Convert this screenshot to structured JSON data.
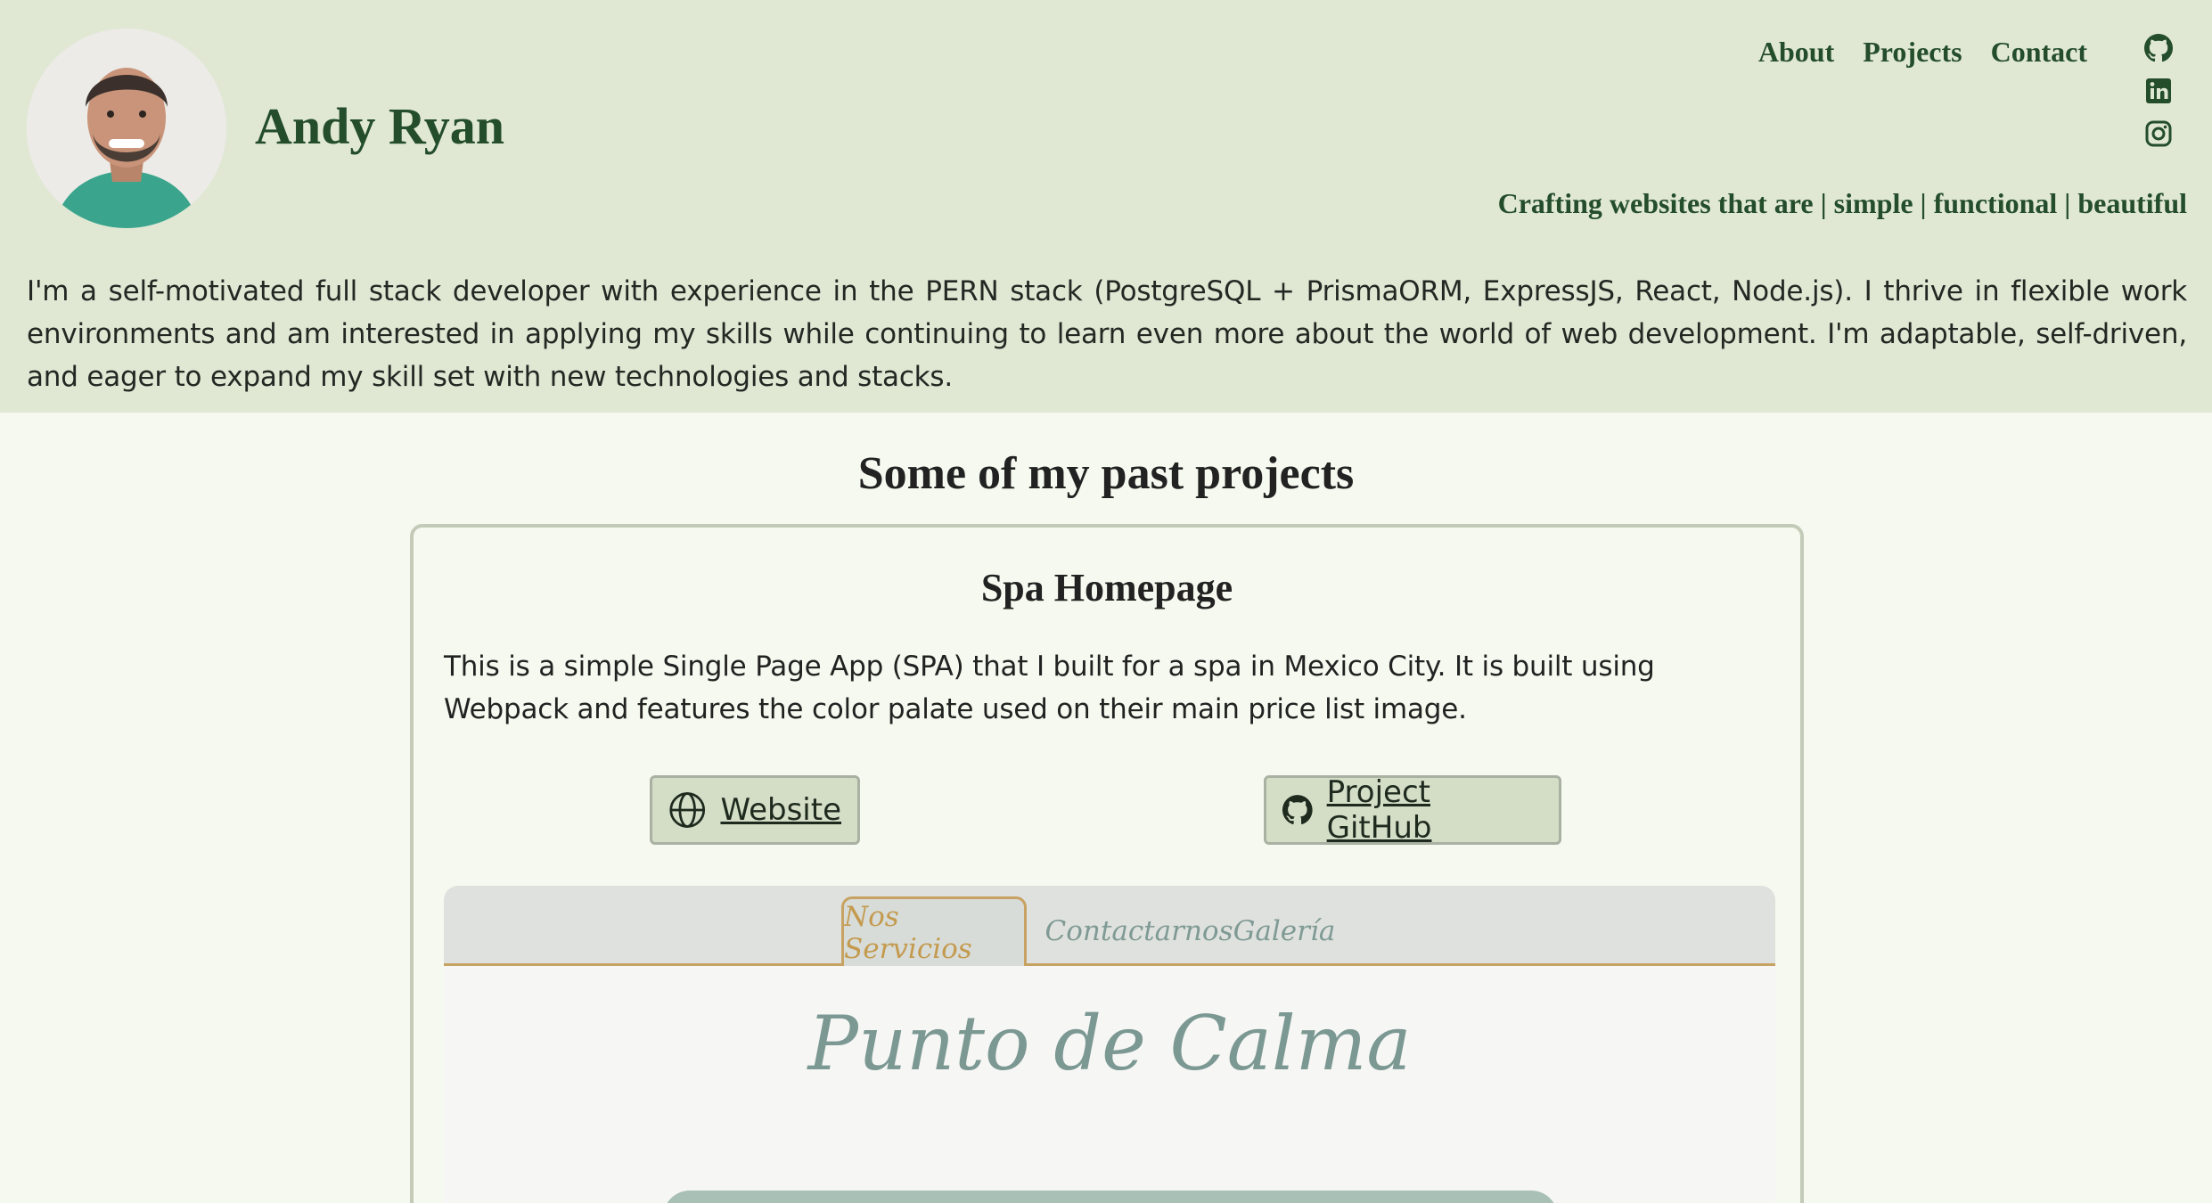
{
  "header": {
    "name": "Andy Ryan",
    "avatar_alt": "avatar",
    "nav": [
      "About",
      "Projects",
      "Contact"
    ],
    "socials": [
      "github-icon",
      "linkedin-icon",
      "instagram-icon"
    ],
    "tagline": "Crafting websites that are | simple | functional | beautiful",
    "bio": "I'm a self-motivated full stack developer with experience in the PERN stack (PostgreSQL + PrismaORM, ExpressJS, React, Node.js). I thrive in flexible work environments and am interested in applying my skills while continuing to learn even more about the world of web development. I'm adaptable, self-driven, and eager to expand my skill set with new technologies and stacks."
  },
  "projects": {
    "heading": "Some of my past projects",
    "items": [
      {
        "title": "Spa Homepage",
        "description": "This is a simple Single Page App (SPA) that I built for a spa in Mexico City. It is built using Webpack and features the color palate used on their main price list image.",
        "website_label": "Website",
        "github_label": "Project GitHub",
        "preview": {
          "tabs": [
            "Nos Servicios",
            "Contactarnos",
            "Galería"
          ],
          "active_tab": "Nos Servicios",
          "brand": "Punto de Calma"
        }
      }
    ]
  },
  "colors": {
    "header_bg": "#e0e8d4",
    "page_bg": "#f6f9ef",
    "brand_green": "#244d2c",
    "button_bg": "#d4ddc6",
    "preview_gold": "#c49a4e",
    "preview_teal": "#7b9892"
  }
}
